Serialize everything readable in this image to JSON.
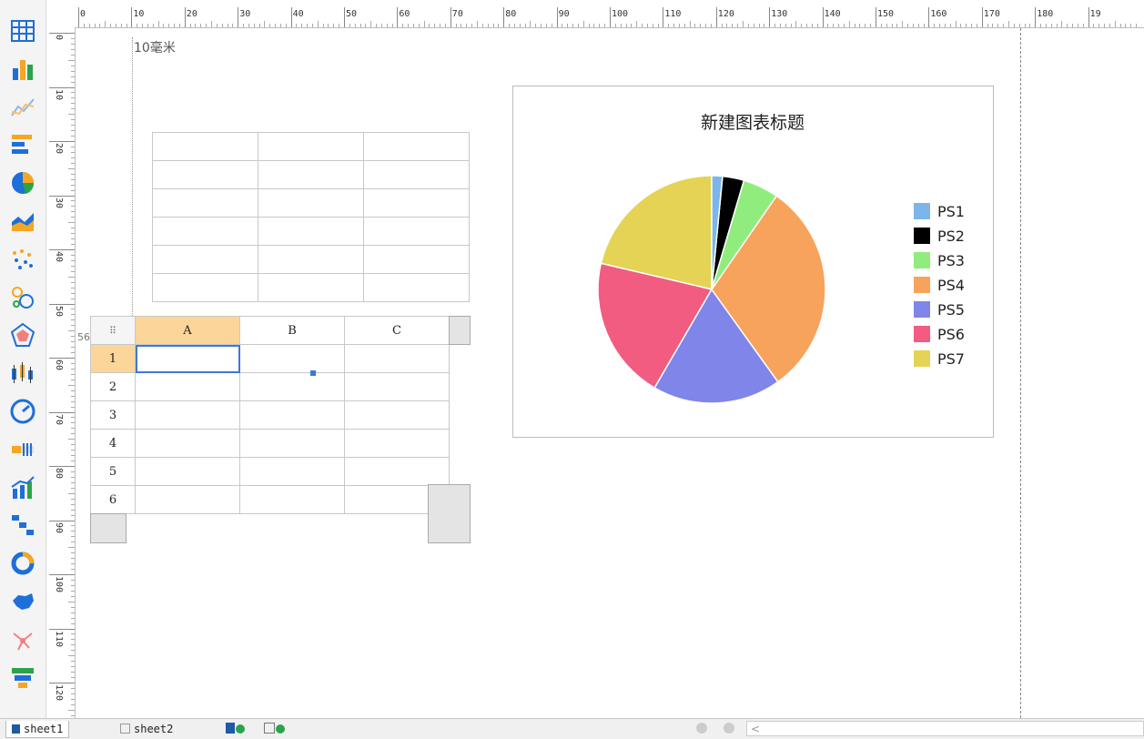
{
  "sheet_tabs": [
    {
      "label": "sheet1",
      "active": true
    },
    {
      "label": "sheet2",
      "active": false
    }
  ],
  "toolbar_icons": [
    "table-icon",
    "bar-chart-icon",
    "line-chart-icon",
    "horizontal-bar-icon",
    "pie-chart-icon",
    "area-chart-icon",
    "scatter-icon",
    "bubble-icon",
    "radar-icon",
    "candlestick-icon",
    "gauge-icon",
    "progress-bar-icon",
    "combo-chart-icon",
    "step-chart-icon",
    "ring-chart-icon",
    "map-icon",
    "network-icon",
    "funnel-icon"
  ],
  "rulers": {
    "h_labels": [
      "0",
      "10",
      "20",
      "30",
      "40",
      "50",
      "60",
      "70",
      "80",
      "90",
      "100",
      "110",
      "120",
      "130",
      "140",
      "150",
      "160",
      "170",
      "180",
      "19"
    ],
    "v_labels": [
      "0",
      "10",
      "20",
      "30",
      "40",
      "50",
      "60",
      "70",
      "80",
      "90",
      "100",
      "110",
      "120"
    ]
  },
  "margin_label": "10毫米",
  "row_marker": "56",
  "spreadsheet": {
    "corner_glyph": "⠿",
    "columns": [
      "A",
      "B",
      "C"
    ],
    "rows": [
      "1",
      "2",
      "3",
      "4",
      "5",
      "6"
    ]
  },
  "chart_data": {
    "type": "pie",
    "title": "新建图表标题",
    "legend_position": "right",
    "categories": [
      "PS1",
      "PS2",
      "PS3",
      "PS4",
      "PS5",
      "PS6",
      "PS7"
    ],
    "values": [
      1.5,
      3,
      5,
      30,
      18,
      20,
      21
    ],
    "colors": [
      "#7cb5ec",
      "#000000",
      "#90ed7d",
      "#f7a35c",
      "#8085e9",
      "#f15c80",
      "#e4d354"
    ]
  }
}
